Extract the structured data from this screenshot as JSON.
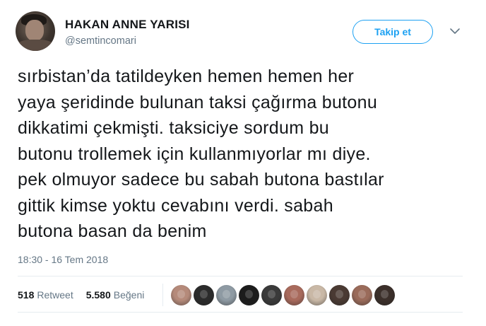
{
  "author": {
    "display_name": "HAKAN ANNE YARISI",
    "handle": "@semtincomari",
    "avatar_icon": "profile-photo"
  },
  "follow_button": {
    "label": "Takip et"
  },
  "menu": {
    "icon": "chevron-down-icon"
  },
  "tweet": {
    "text": "sırbistan’da tatildeyken hemen hemen her\nyaya şeridinde bulunan taksi çağırma butonu\ndikkatimi çekmişti. taksiciye sordum bu\nbutonu trollemek için kullanmıyorlar mı diye.\npek olmuyor sadece bu sabah butona bastılar\ngittik kimse yoktu cevabını verdi. sabah\nbutona basan da benim",
    "timestamp": "18:30 - 16 Tem 2018"
  },
  "stats": {
    "retweet_count": "518",
    "retweet_label": "Retweet",
    "like_count": "5.580",
    "like_label": "Beğeni"
  },
  "likers": [
    {
      "color": "#b58a7a"
    },
    {
      "color": "#2b2b2b"
    },
    {
      "color": "#8e9aa3"
    },
    {
      "color": "#1c1c1c"
    },
    {
      "color": "#3a3a3a"
    },
    {
      "color": "#a86a5c"
    },
    {
      "color": "#c9b8a6"
    },
    {
      "color": "#4a3a33"
    },
    {
      "color": "#9a6b5a"
    },
    {
      "color": "#3b2f2a"
    }
  ],
  "colors": {
    "accent": "#1da1f2",
    "text_primary": "#14171a",
    "text_secondary": "#657786",
    "divider": "#e6ecf0"
  }
}
